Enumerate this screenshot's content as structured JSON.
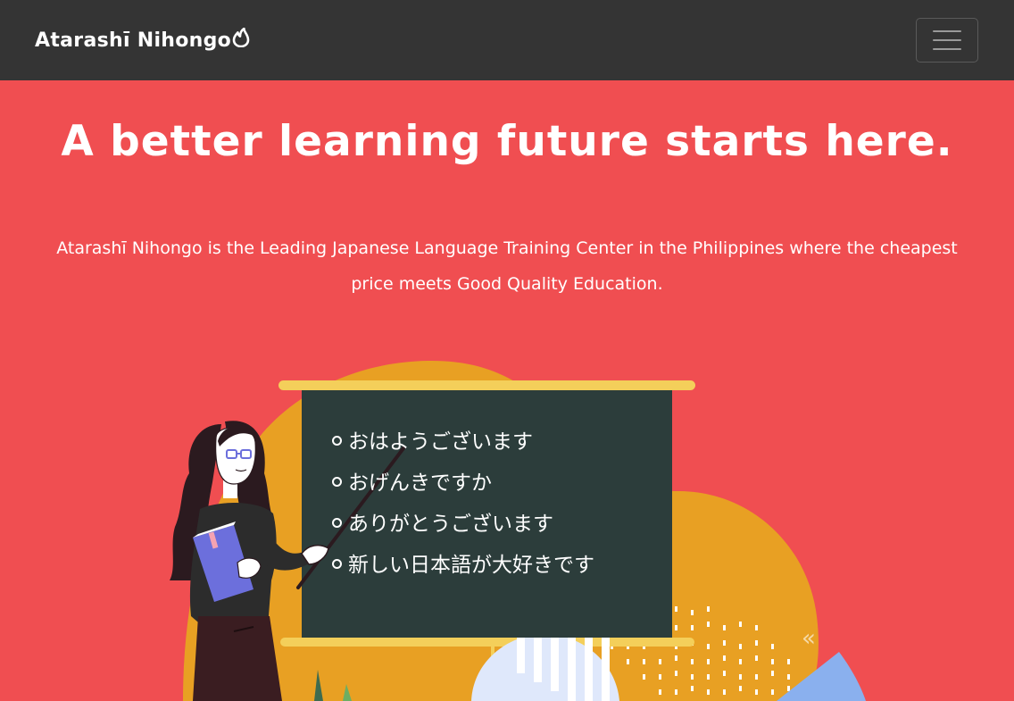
{
  "navbar": {
    "brand": "Atarashī Nihongo",
    "brand_icon": "flame-icon",
    "toggler_icon": "hamburger-menu-icon",
    "background": "#343434"
  },
  "hero": {
    "headline": "A better learning future starts here.",
    "lead": "Atarashī Nihongo is the Leading Japanese Language Training Center in the Philippines where the cheapest price meets Good Quality Education.",
    "background": "#f04e51",
    "board": {
      "lines": [
        "おはようございます",
        "おげんきですか",
        "ありがとうございます",
        "新しい日本語が大好きです"
      ]
    }
  },
  "colors": {
    "accent_orange": "#e8a023",
    "board": "#2c3d3b",
    "board_frame": "#f4cf5a",
    "book": "#6c6fdc"
  }
}
